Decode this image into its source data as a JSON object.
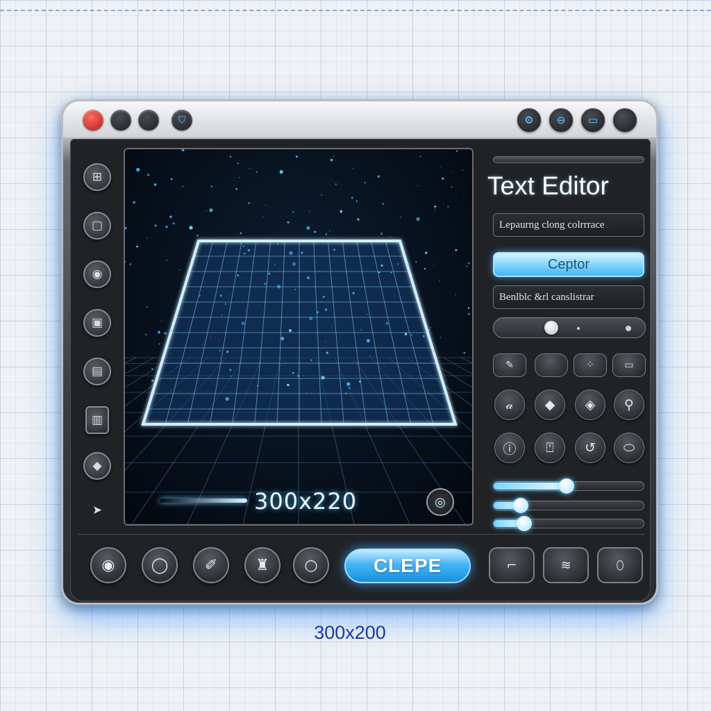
{
  "canvas": {
    "size_readout": "300x220"
  },
  "panel": {
    "title": "Text Editor",
    "field1_text": "Lepaurng clong colrrrace",
    "accent_button": "Ceptor",
    "field2_text": "Benlblc &rl canslistrar"
  },
  "sliders": {
    "top_slider_level": 0.35,
    "glow_levels": [
      0.48,
      0.18,
      0.2
    ]
  },
  "bottom": {
    "primary_button": "CLEPE"
  },
  "caption": "300x200",
  "colors": {
    "accent": "#3aa8f0",
    "close_dot": "#d9403a",
    "caption": "#1a3aa8"
  },
  "icons": {
    "titlebar_right": [
      "settings-icon",
      "toggle-icon",
      "window-icon",
      "circle-icon"
    ],
    "left_tools": [
      "frame-icon",
      "square-tool-icon",
      "circle-tool-icon",
      "image-icon",
      "photo-icon",
      "bar-icon",
      "shape-icon",
      "arrow-icon"
    ]
  }
}
